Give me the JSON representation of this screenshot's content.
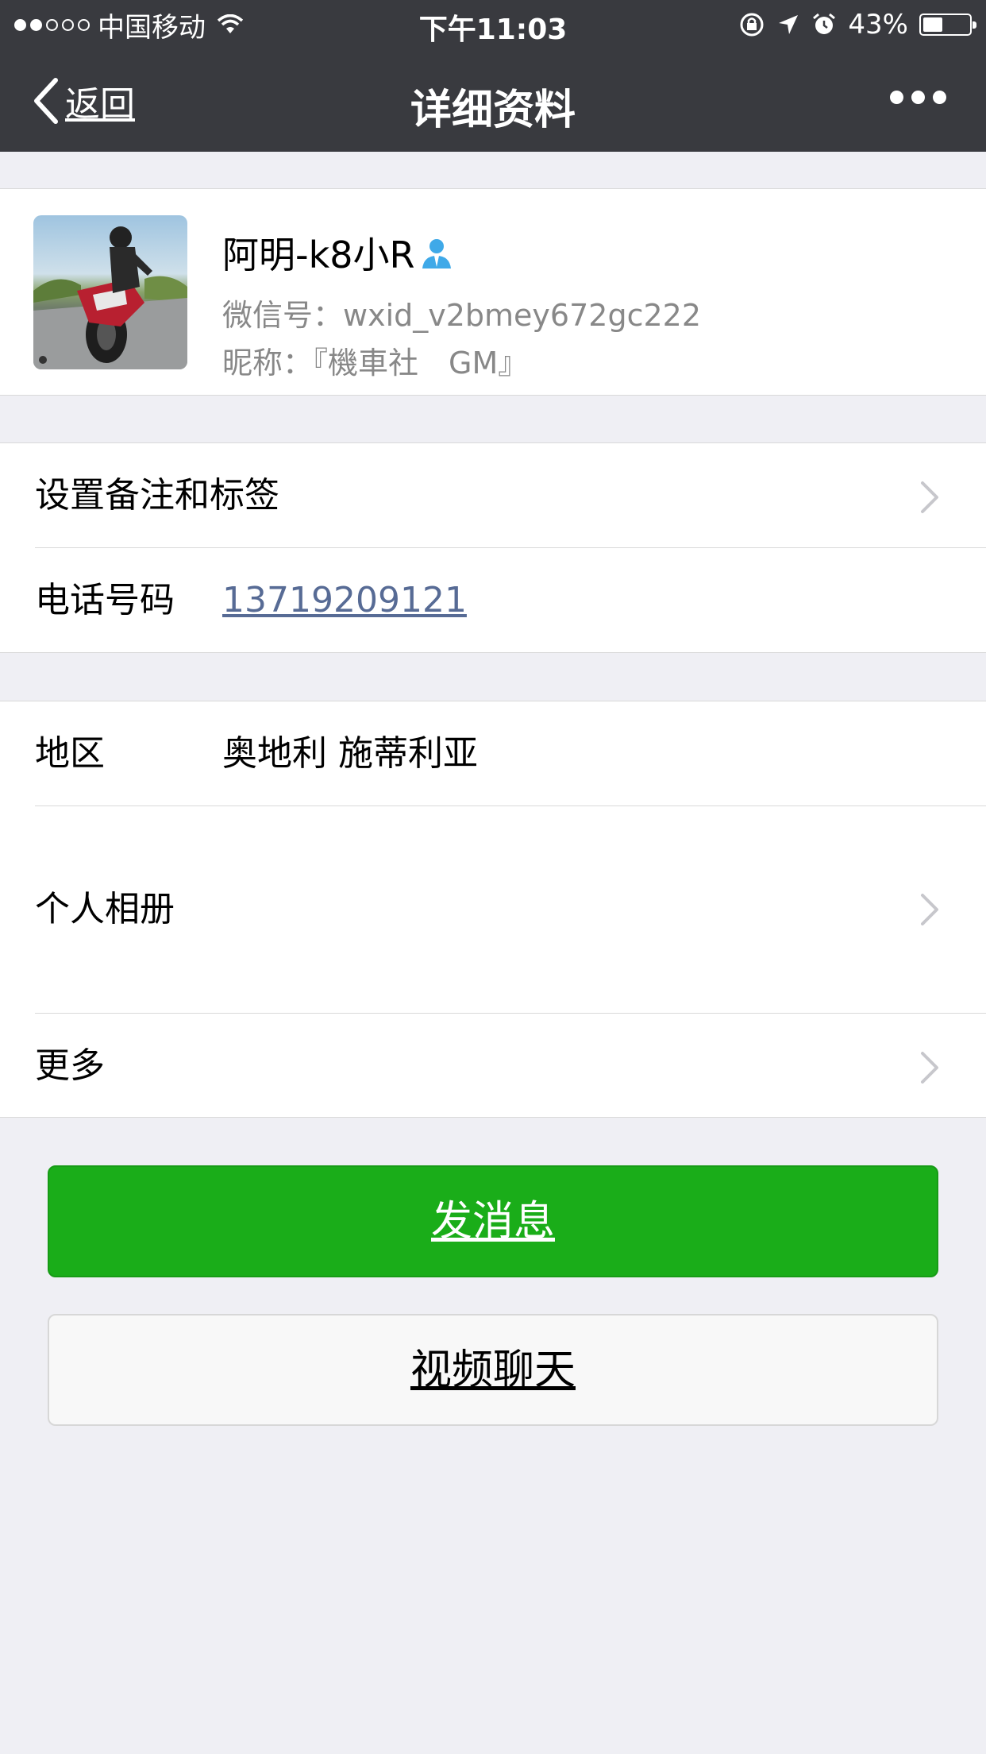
{
  "status_bar": {
    "carrier": "中国移动",
    "time": "下午11:03",
    "battery": "43%",
    "battery_level": 0.43
  },
  "nav": {
    "back_label": "返回",
    "title": "详细资料",
    "more_icon": "more-dots-icon"
  },
  "profile": {
    "name": "阿明-k8小R",
    "wechat_id": "微信号：wxid_v2bmey672gc222",
    "nickname": "昵称：『機車社　GM』",
    "avatar_icon": "motorcycle-rider-photo",
    "badge_icon": "person-badge-icon",
    "badge_color": "#3fa9e8"
  },
  "rows": {
    "remark": {
      "label": "设置备注和标签"
    },
    "phone": {
      "label": "电话号码",
      "value": "13719209121"
    },
    "region": {
      "label": "地区",
      "value": "奥地利 施蒂利亚"
    },
    "album": {
      "label": "个人相册"
    },
    "more": {
      "label": "更多"
    }
  },
  "buttons": {
    "send": "发消息",
    "video": "视频聊天"
  },
  "colors": {
    "nav_bg": "#393a3f",
    "page_bg": "#efeff4",
    "primary_green": "#1aad19",
    "link_blue": "#576b95"
  }
}
